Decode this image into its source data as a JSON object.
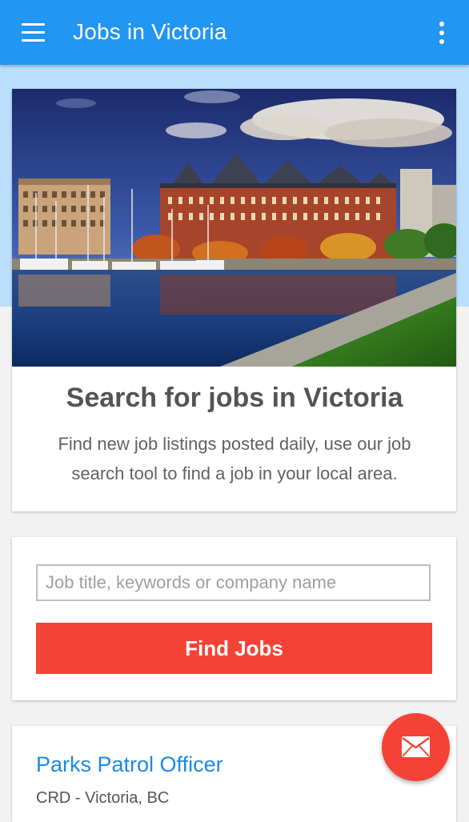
{
  "app_bar": {
    "title": "Jobs in Victoria",
    "menu_icon": "hamburger-menu-icon",
    "overflow_icon": "more-vert-icon",
    "color": "#2196f3"
  },
  "hero": {
    "image": "victoria-harbour-photo",
    "heading": "Search for jobs in Victoria",
    "subtext": "Find new job listings posted daily, use our job search tool to find a job in your local area."
  },
  "search": {
    "placeholder": "Job title, keywords or company name",
    "value": "",
    "button_label": "Find Jobs",
    "button_color": "#f44336"
  },
  "jobs": [
    {
      "title": "Parks Patrol Officer",
      "location": "CRD - Victoria, BC"
    }
  ],
  "fab": {
    "icon": "mail-icon",
    "color": "#f44336"
  }
}
